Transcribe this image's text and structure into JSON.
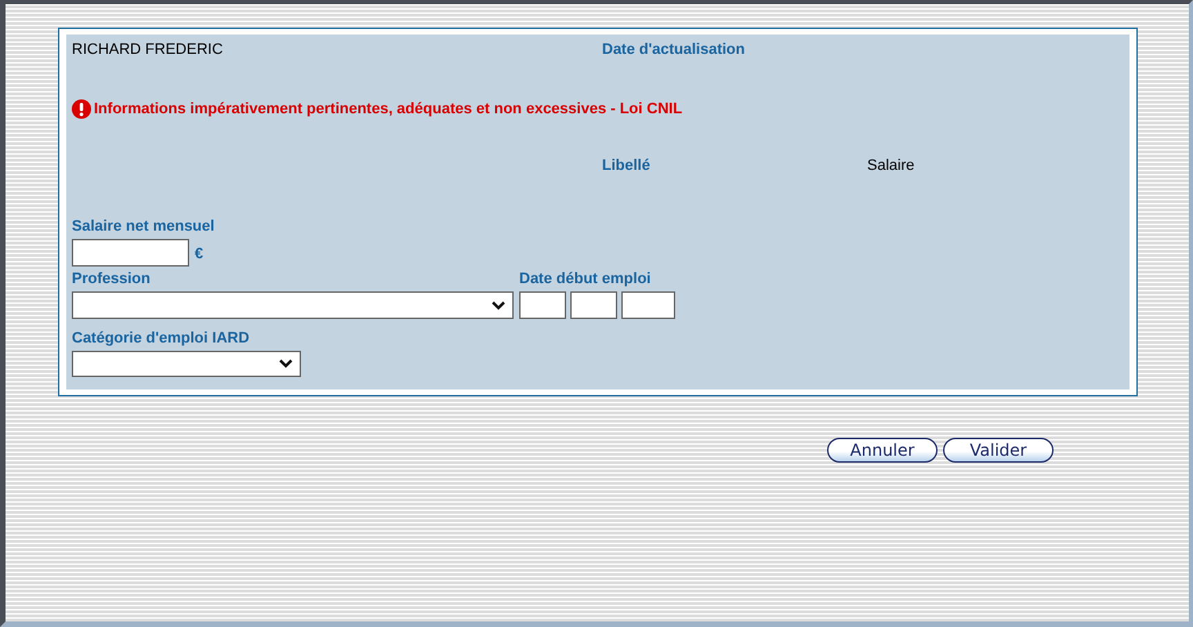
{
  "header": {
    "name": "RICHARD FREDERIC",
    "date_label": "Date d'actualisation"
  },
  "warning": "Informations impérativement pertinentes, adéquates et non excessives - Loi CNIL",
  "libelle": {
    "label": "Libellé",
    "value": "Salaire"
  },
  "salary": {
    "label": "Salaire net mensuel",
    "currency": "€"
  },
  "profession": {
    "label": "Profession"
  },
  "start_date": {
    "label": "Date début emploi"
  },
  "category": {
    "label": "Catégorie d'emploi IARD"
  },
  "buttons": [
    "Annuler",
    "Valider"
  ]
}
